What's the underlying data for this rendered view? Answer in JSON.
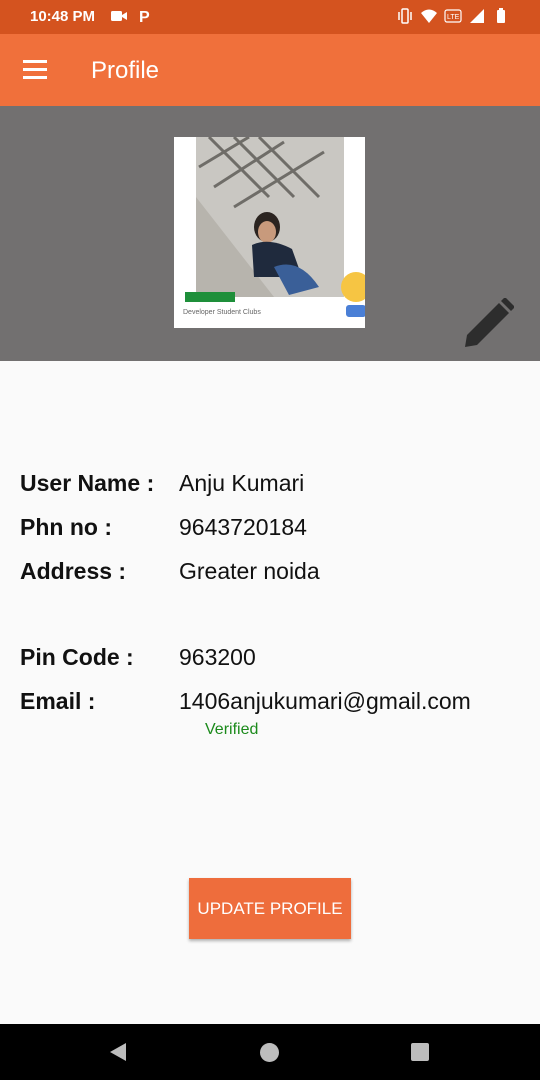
{
  "status_bar": {
    "time": "10:48 PM",
    "left_icons": [
      "video-camera-icon",
      "parking-icon"
    ],
    "right_icons": [
      "vibrate-icon",
      "wifi-icon",
      "volte-icon",
      "signal-icon",
      "battery-icon"
    ]
  },
  "app_bar": {
    "title": "Profile",
    "menu_icon": "menu-icon"
  },
  "profile": {
    "photo_caption": "Developer Student Clubs",
    "rows": [
      {
        "label": "User Name :",
        "value": "Anju Kumari"
      },
      {
        "label": "Phn no :",
        "value": "9643720184"
      },
      {
        "label": "Address :",
        "value": "Greater noida"
      },
      {
        "label": "Pin Code :",
        "value": "963200"
      },
      {
        "label": "Email :",
        "value": "1406anjukumari@gmail.com"
      }
    ],
    "email_status": "Verified"
  },
  "actions": {
    "update_label": "UPDATE PROFILE"
  },
  "colors": {
    "status_bar": "#d4531f",
    "app_bar": "#f0703b",
    "header_panel": "#727070",
    "button": "#ee6d3c",
    "verified": "#1b8a1b"
  }
}
